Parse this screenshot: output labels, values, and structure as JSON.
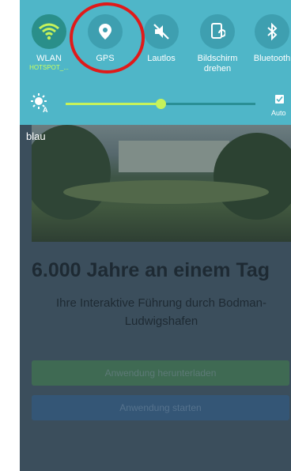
{
  "quick_settings": {
    "tiles": [
      {
        "label": "WLAN",
        "sublabel": "HOTSPOT_...",
        "icon": "wifi-icon",
        "state": "on"
      },
      {
        "label": "GPS",
        "icon": "location-pin-icon",
        "state": "off"
      },
      {
        "label": "Lautlos",
        "icon": "mute-icon",
        "state": "off"
      },
      {
        "label": "Bildschirm drehen",
        "icon": "screen-rotate-icon",
        "state": "off"
      },
      {
        "label": "Bluetooth",
        "icon": "bluetooth-icon",
        "state": "off"
      }
    ],
    "brightness": {
      "level_fraction": 0.5,
      "auto_label": "Auto",
      "auto_checked": true
    },
    "highlight_color": "#e01a1a"
  },
  "app": {
    "hero_label": "blau",
    "title": "6.000 Jahre an einem Tag",
    "subtitle": "Ihre Interaktive Führung durch Bodman-Ludwigshafen",
    "download_button": "Anwendung herunterladen",
    "start_button": "Anwendung starten"
  }
}
